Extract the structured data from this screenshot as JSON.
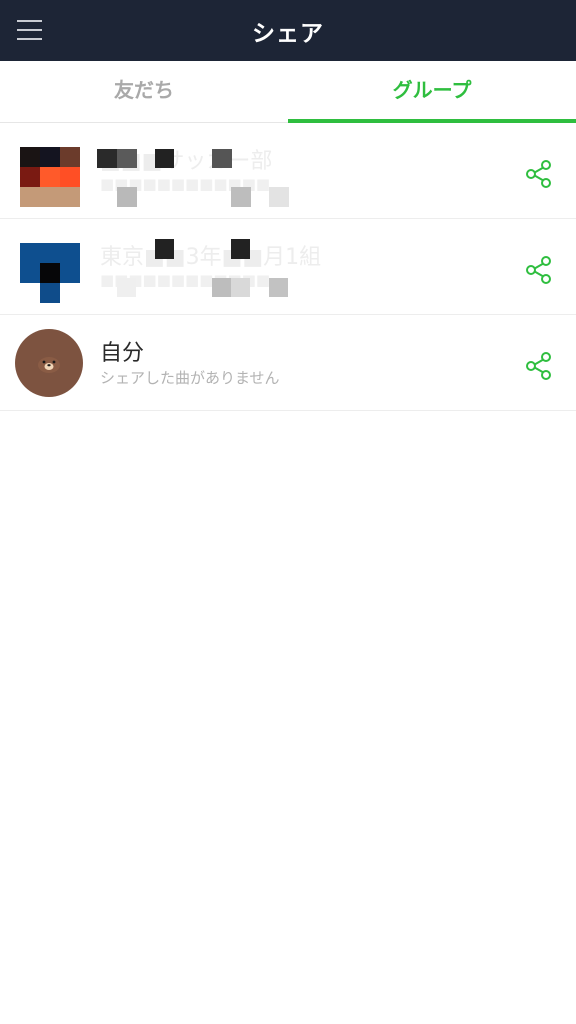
{
  "header": {
    "title": "シェア",
    "menu_icon": "hamburger-menu-icon"
  },
  "tabs": [
    {
      "label": "友だち",
      "active": false
    },
    {
      "label": "グループ",
      "active": true
    }
  ],
  "colors": {
    "header_bg": "#1d2536",
    "accent": "#2fbe3f",
    "inactive_tab": "#a9a9a9"
  },
  "groups": [
    {
      "title": "■■■サッカー部",
      "subtitle": "■■■■■■■■■■■■"
    },
    {
      "title": "東京■■3年■■月1組",
      "subtitle": "■■■■■■■■■■■■"
    },
    {
      "title": "自分",
      "subtitle": "シェアした曲がありません"
    }
  ]
}
